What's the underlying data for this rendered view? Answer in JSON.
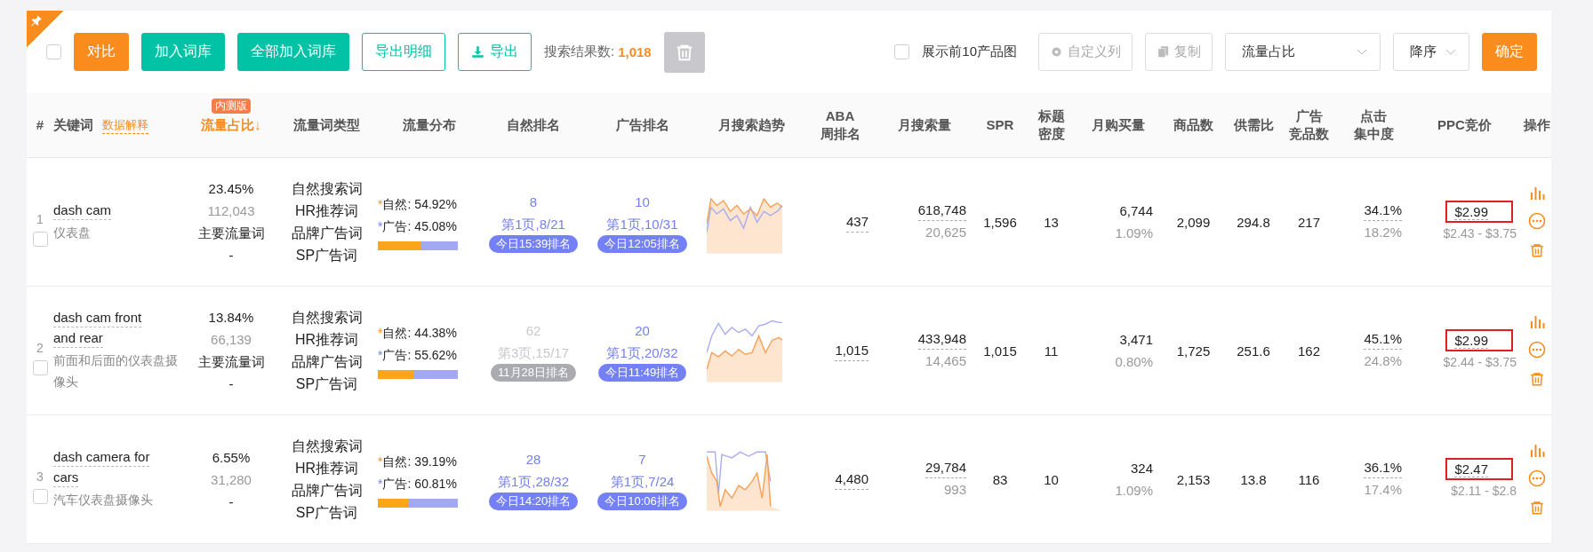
{
  "toolbar": {
    "select_all": {
      "checked": false
    },
    "buttons": [
      {
        "label": "对比",
        "kind": "primary"
      },
      {
        "label": "加入词库",
        "kind": "accent"
      },
      {
        "label": "全部加入词库",
        "kind": "accent"
      },
      {
        "label": "导出明细",
        "kind": "outline"
      },
      {
        "label": "导出",
        "kind": "download"
      }
    ],
    "result_label": "搜索结果数:",
    "result_count": "1,018",
    "show_top10": {
      "label": "展示前10产品图",
      "checked": false
    },
    "custom_columns": "自定义列",
    "copy": "复制",
    "sort_field": "流量占比",
    "sort_order": "降序",
    "confirm": "确定"
  },
  "columns": [
    {
      "lines": [
        "#"
      ],
      "sorted": false
    },
    {
      "lines": [
        "关键词"
      ],
      "extra": "数据解释",
      "sorted": false
    },
    {
      "lines": [
        "流量占比↓"
      ],
      "badge": "内测版",
      "sorted": true
    },
    {
      "lines": [
        "流量词类型"
      ],
      "sorted": false
    },
    {
      "lines": [
        "流量分布"
      ],
      "sorted": false
    },
    {
      "lines": [
        "自然排名"
      ],
      "sorted": false
    },
    {
      "lines": [
        "广告排名"
      ],
      "sorted": false
    },
    {
      "lines": [
        "月搜索趋势"
      ],
      "sorted": false
    },
    {
      "lines": [
        "ABA",
        "周排名"
      ],
      "sorted": false
    },
    {
      "lines": [
        "月搜索量"
      ],
      "sorted": false
    },
    {
      "lines": [
        "SPR"
      ],
      "sorted": false
    },
    {
      "lines": [
        "标题",
        "密度"
      ],
      "sorted": false
    },
    {
      "lines": [
        "月购买量"
      ],
      "sorted": false
    },
    {
      "lines": [
        "商品数"
      ],
      "sorted": false
    },
    {
      "lines": [
        "供需比"
      ],
      "sorted": false
    },
    {
      "lines": [
        "广告",
        "竞品数"
      ],
      "sorted": false
    },
    {
      "lines": [
        "点击",
        "集中度"
      ],
      "sorted": false
    },
    {
      "lines": [
        "PPC竞价"
      ],
      "sorted": false
    },
    {
      "lines": [
        "操作"
      ],
      "sorted": false
    }
  ],
  "rows": [
    {
      "index": "1",
      "checked": false,
      "keyword": [
        "dash cam"
      ],
      "translation": "仪表盘",
      "share": "23.45%",
      "share_volume": "112,043",
      "share_label": "主要流量词",
      "share_extra": "-",
      "types": [
        "自然搜索词",
        "HR推荐词",
        "品牌广告词",
        "SP广告词"
      ],
      "dist": {
        "star": "*",
        "natural_label": "自然:",
        "natural": "54.92%",
        "ad_label": "广告:",
        "ad": "45.08%",
        "level": 0.5492
      },
      "natural_rank": {
        "rank": "8",
        "page": "第1页,8/21",
        "time": "今日15:39排名",
        "stale": false
      },
      "ad_rank": {
        "rank": "10",
        "page": "第1页,10/31",
        "time": "今日12:05排名",
        "stale": false
      },
      "aba": "437",
      "search": "618,748",
      "search_sub": "20,625",
      "spr": "1,596",
      "title_density": "13",
      "purchase": "6,744",
      "purchase_rate": "1.09%",
      "products": "2,099",
      "supply_demand": "294.8",
      "ad_products": "217",
      "click": "34.1%",
      "click_sub": "18.2%",
      "ppc": "$2.99",
      "ppc_range": "$2.43 - $3.75",
      "ppc_highlighted": true
    },
    {
      "index": "2",
      "checked": false,
      "keyword": [
        "dash cam front",
        "and rear"
      ],
      "translation": "前面和后面的仪表盘摄像头",
      "share": "13.84%",
      "share_volume": "66,139",
      "share_label": "主要流量词",
      "share_extra": "-",
      "types": [
        "自然搜索词",
        "HR推荐词",
        "品牌广告词",
        "SP广告词"
      ],
      "dist": {
        "star": "*",
        "natural_label": "自然:",
        "natural": "44.38%",
        "ad_label": "广告:",
        "ad": "55.62%",
        "level": 0.4438
      },
      "natural_rank": {
        "rank": "62",
        "page": "第3页,15/17",
        "time": "11月28日排名",
        "stale": true
      },
      "ad_rank": {
        "rank": "20",
        "page": "第1页,20/32",
        "time": "今日11:49排名",
        "stale": false
      },
      "aba": "1,015",
      "search": "433,948",
      "search_sub": "14,465",
      "spr": "1,015",
      "title_density": "11",
      "purchase": "3,471",
      "purchase_rate": "0.80%",
      "products": "1,725",
      "supply_demand": "251.6",
      "ad_products": "162",
      "click": "45.1%",
      "click_sub": "24.8%",
      "ppc": "$2.99",
      "ppc_range": "$2.44 - $3.75",
      "ppc_highlighted": true
    },
    {
      "index": "3",
      "checked": false,
      "keyword": [
        "dash camera for",
        "cars"
      ],
      "translation": "汽车仪表盘摄像头",
      "share": "6.55%",
      "share_volume": "31,280",
      "share_extra": "-",
      "types": [
        "自然搜索词",
        "HR推荐词",
        "品牌广告词",
        "SP广告词"
      ],
      "dist": {
        "star": "*",
        "natural_label": "自然:",
        "natural": "39.19%",
        "ad_label": "广告:",
        "ad": "60.81%",
        "level": 0.3919
      },
      "natural_rank": {
        "rank": "28",
        "page": "第1页,28/32",
        "time": "今日14:20排名",
        "stale": false
      },
      "ad_rank": {
        "rank": "7",
        "page": "第1页,7/24",
        "time": "今日10:06排名",
        "stale": false
      },
      "aba": "4,480",
      "search": "29,784",
      "search_sub": "993",
      "spr": "83",
      "title_density": "10",
      "purchase": "324",
      "purchase_rate": "1.09%",
      "products": "2,153",
      "supply_demand": "13.8",
      "ad_products": "116",
      "click": "36.1%",
      "click_sub": "17.4%",
      "ppc": "$2.47",
      "ppc_range": "$2.11 - $2.8",
      "ppc_highlighted": true
    }
  ]
}
